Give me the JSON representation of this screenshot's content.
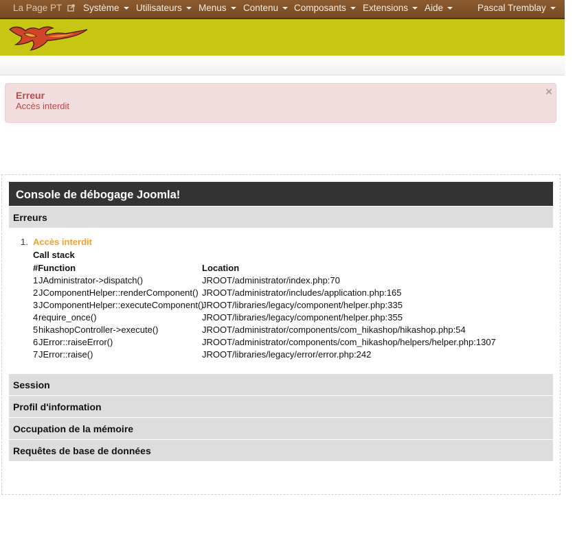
{
  "navbar": {
    "brand": "La Page PT",
    "menus": [
      "Système",
      "Utilisateurs",
      "Menus",
      "Contenu",
      "Composants",
      "Extensions",
      "Aide"
    ],
    "user": "Pascal Tremblay"
  },
  "alert": {
    "title": "Erreur",
    "message": "Accès interdit",
    "close": "×"
  },
  "debug": {
    "title": "Console de débogage Joomla!",
    "errors_label": "Erreurs",
    "error_number": "1.",
    "error_link": "Accès interdit",
    "callstack_label": "Call stack",
    "columns": [
      "#Function",
      "Location"
    ],
    "rows": [
      {
        "num": "1",
        "func": "JAdministrator->dispatch()",
        "loc": "JROOT/administrator/index.php:70"
      },
      {
        "num": "2",
        "func": "JComponentHelper::renderComponent()",
        "loc": "JROOT/administrator/includes/application.php:165"
      },
      {
        "num": "3",
        "func": "JComponentHelper::executeComponent()",
        "loc": "JROOT/libraries/legacy/component/helper.php:335"
      },
      {
        "num": "4",
        "func": "require_once()",
        "loc": "JROOT/libraries/legacy/component/helper.php:355"
      },
      {
        "num": "5",
        "func": "hikashopController->execute()",
        "loc": "JROOT/administrator/components/com_hikashop/hikashop.php:54"
      },
      {
        "num": "6",
        "func": "JError::raiseError()",
        "loc": "JROOT/administrator/components/com_hikashop/helpers/helper.php:1307"
      },
      {
        "num": "7",
        "func": "JError::raise()",
        "loc": "JROOT/libraries/legacy/error/error.php:242"
      }
    ],
    "sections": [
      "Session",
      "Profil d'information",
      "Occupation de la mémoire",
      "Requêtes de base de données"
    ]
  },
  "colors": {
    "navbar": "#7a4b22",
    "header": "#c7c713",
    "alert_bg": "#f2dede",
    "alert_text": "#b94a48",
    "error_link": "#f0a030"
  }
}
